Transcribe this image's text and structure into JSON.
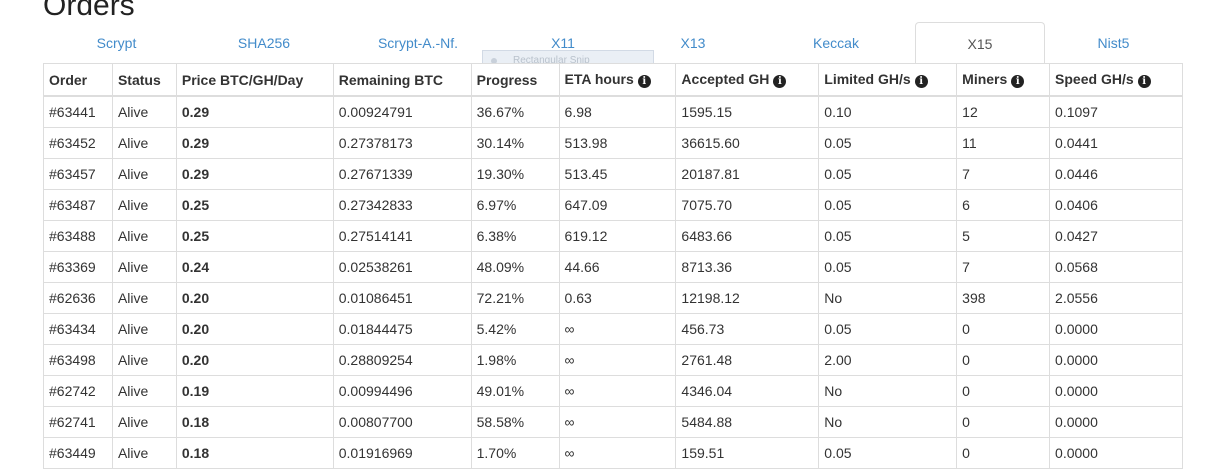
{
  "page": {
    "title": "Orders"
  },
  "tabs": [
    {
      "label": "Scrypt",
      "active": false
    },
    {
      "label": "SHA256",
      "active": false
    },
    {
      "label": "Scrypt-A.-Nf.",
      "active": false
    },
    {
      "label": "X11",
      "active": false
    },
    {
      "label": "X13",
      "active": false
    },
    {
      "label": "Keccak",
      "active": false
    },
    {
      "label": "X15",
      "active": true
    },
    {
      "label": "Nist5",
      "active": false
    }
  ],
  "overlay": {
    "label": "Rectangular Snip"
  },
  "table": {
    "columns": [
      {
        "label": "Order",
        "info": false
      },
      {
        "label": "Status",
        "info": false
      },
      {
        "label": "Price BTC/GH/Day",
        "info": false
      },
      {
        "label": "Remaining BTC",
        "info": false
      },
      {
        "label": "Progress",
        "info": false
      },
      {
        "label": "ETA hours",
        "info": true
      },
      {
        "label": "Accepted GH",
        "info": true
      },
      {
        "label": "Limited GH/s",
        "info": true
      },
      {
        "label": "Miners",
        "info": true
      },
      {
        "label": "Speed GH/s",
        "info": true
      }
    ],
    "rows": [
      [
        "#63441",
        "Alive",
        "0.29",
        "0.00924791",
        "36.67%",
        "6.98",
        "1595.15",
        "0.10",
        "12",
        "0.1097"
      ],
      [
        "#63452",
        "Alive",
        "0.29",
        "0.27378173",
        "30.14%",
        "513.98",
        "36615.60",
        "0.05",
        "11",
        "0.0441"
      ],
      [
        "#63457",
        "Alive",
        "0.29",
        "0.27671339",
        "19.30%",
        "513.45",
        "20187.81",
        "0.05",
        "7",
        "0.0446"
      ],
      [
        "#63487",
        "Alive",
        "0.25",
        "0.27342833",
        "6.97%",
        "647.09",
        "7075.70",
        "0.05",
        "6",
        "0.0406"
      ],
      [
        "#63488",
        "Alive",
        "0.25",
        "0.27514141",
        "6.38%",
        "619.12",
        "6483.66",
        "0.05",
        "5",
        "0.0427"
      ],
      [
        "#63369",
        "Alive",
        "0.24",
        "0.02538261",
        "48.09%",
        "44.66",
        "8713.36",
        "0.05",
        "7",
        "0.0568"
      ],
      [
        "#62636",
        "Alive",
        "0.20",
        "0.01086451",
        "72.21%",
        "0.63",
        "12198.12",
        "No",
        "398",
        "2.0556"
      ],
      [
        "#63434",
        "Alive",
        "0.20",
        "0.01844475",
        "5.42%",
        "∞",
        "456.73",
        "0.05",
        "0",
        "0.0000"
      ],
      [
        "#63498",
        "Alive",
        "0.20",
        "0.28809254",
        "1.98%",
        "∞",
        "2761.48",
        "2.00",
        "0",
        "0.0000"
      ],
      [
        "#62742",
        "Alive",
        "0.19",
        "0.00994496",
        "49.01%",
        "∞",
        "4346.04",
        "No",
        "0",
        "0.0000"
      ],
      [
        "#62741",
        "Alive",
        "0.18",
        "0.00807700",
        "58.58%",
        "∞",
        "5484.88",
        "No",
        "0",
        "0.0000"
      ],
      [
        "#63449",
        "Alive",
        "0.18",
        "0.01916969",
        "1.70%",
        "∞",
        "159.51",
        "0.05",
        "0",
        "0.0000"
      ]
    ]
  },
  "icons": {
    "info": "info-circle-icon"
  },
  "colors": {
    "link": "#428bca",
    "text": "#333333",
    "border": "#dddddd"
  }
}
